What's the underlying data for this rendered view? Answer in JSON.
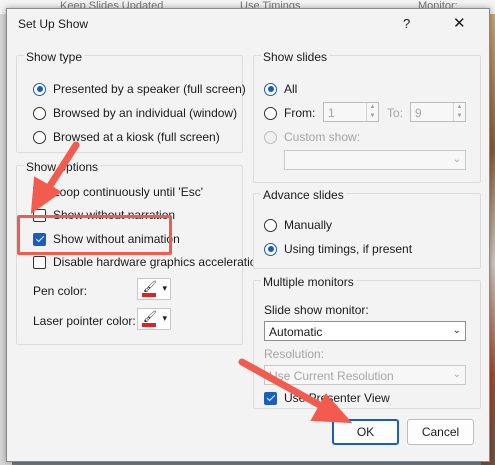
{
  "background": {
    "top_texts": [
      "Keep Slides Updated",
      "Use Timings",
      "Monitor: Automatic"
    ]
  },
  "dialog": {
    "title": "Set Up Show",
    "help_label": "?",
    "close_label": "✕",
    "show_type": {
      "title": "Show type",
      "options": [
        "Presented by a speaker (full screen)",
        "Browsed by an individual (window)",
        "Browsed at a kiosk (full screen)"
      ],
      "selected": 0
    },
    "show_options": {
      "title": "Show options",
      "loop": "Loop continuously until 'Esc'",
      "without_narration": "Show without narration",
      "without_animation": "Show without animation",
      "disable_hw": "Disable hardware graphics acceleration",
      "pen_color_label": "Pen color:",
      "laser_color_label": "Laser pointer color:"
    },
    "show_slides": {
      "title": "Show slides",
      "all_label": "All",
      "from_label": "From:",
      "from_value": "1",
      "to_label": "To:",
      "to_value": "9",
      "custom_label": "Custom show:",
      "custom_value": ""
    },
    "advance_slides": {
      "title": "Advance slides",
      "manually": "Manually",
      "using_timings": "Using timings, if present"
    },
    "monitors": {
      "title": "Multiple monitors",
      "monitor_label": "Slide show monitor:",
      "monitor_value": "Automatic",
      "resolution_label": "Resolution:",
      "resolution_value": "Use Current Resolution",
      "presenter_view": "Use Presenter View"
    },
    "ok_label": "OK",
    "cancel_label": "Cancel"
  },
  "colors": {
    "accent": "#1a5dbc",
    "annotation": "#f25b4d",
    "pen": "#e12020"
  }
}
